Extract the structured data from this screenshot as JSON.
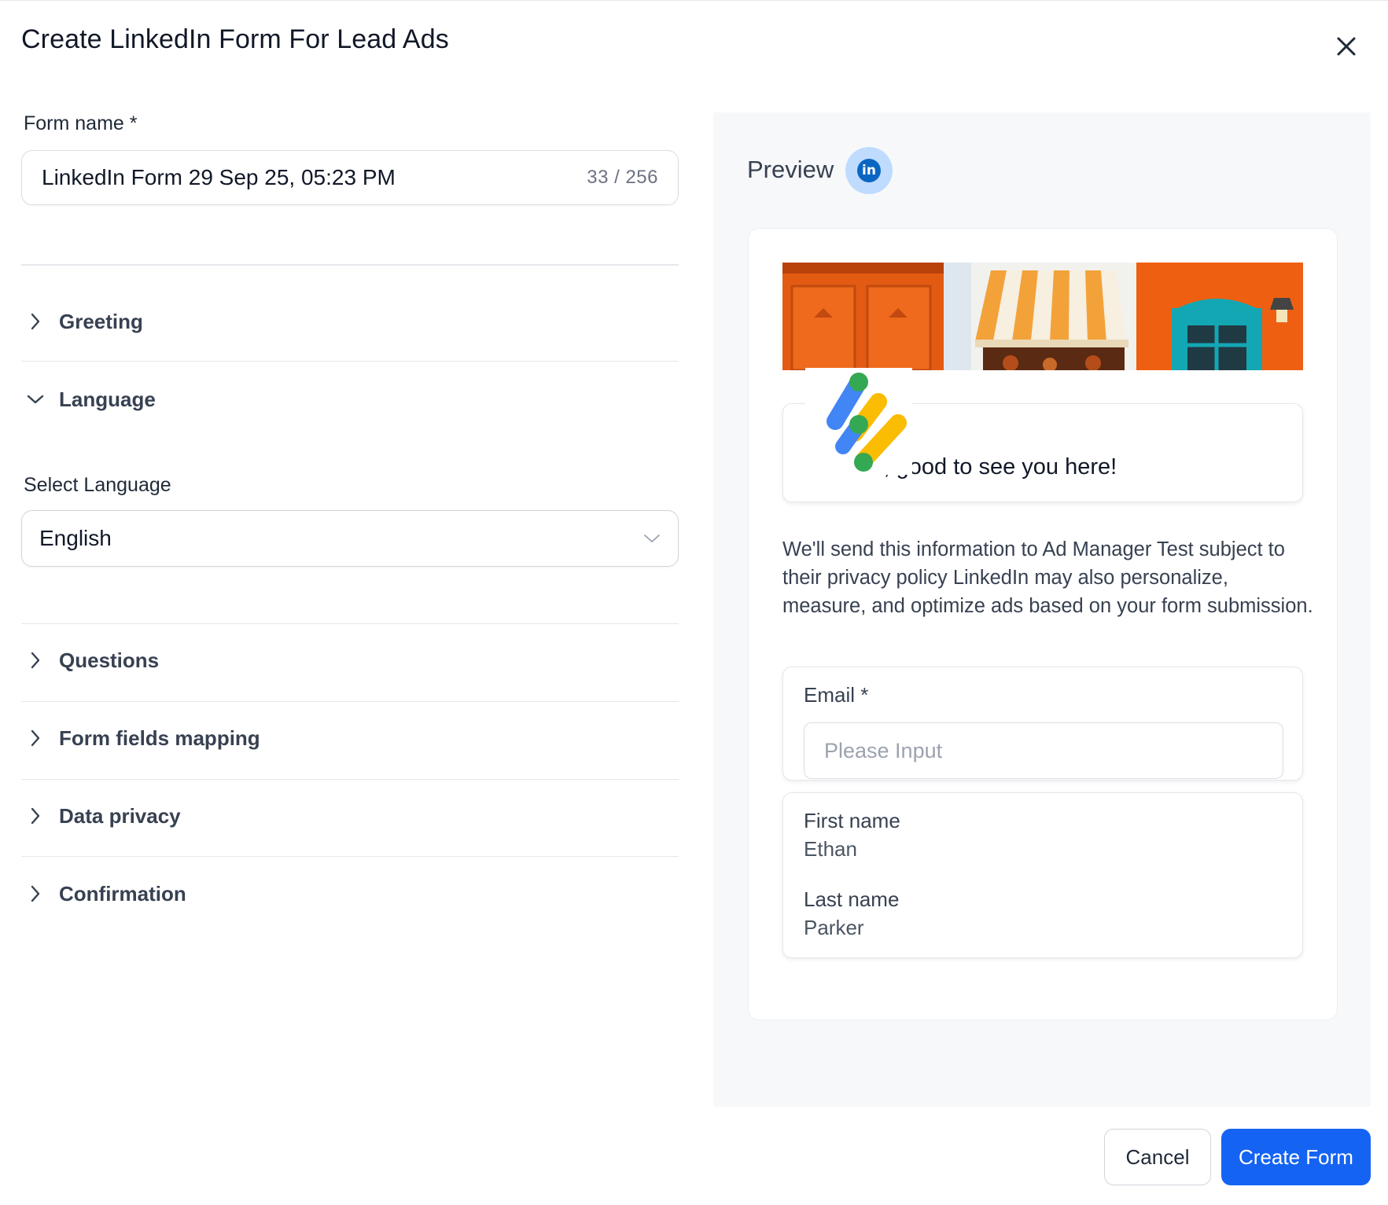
{
  "modal": {
    "title": "Create LinkedIn Form For Lead Ads"
  },
  "form": {
    "name_label": "Form name *",
    "name_value": "LinkedIn Form 29 Sep 25, 05:23 PM",
    "name_counter": "33 / 256"
  },
  "sections": {
    "greeting": "Greeting",
    "language": "Language",
    "questions": "Questions",
    "form_fields_mapping": "Form fields mapping",
    "data_privacy": "Data privacy",
    "confirmation": "Confirmation"
  },
  "language": {
    "select_label": "Select Language",
    "selected": "English"
  },
  "preview": {
    "title": "Preview",
    "badge": "in",
    "greeting_text": "Hi there, good to see you here!",
    "privacy_text": "We'll send this information to Ad Manager Test subject to their privacy policy LinkedIn may also personalize, measure, and optimize ads based on your form submission.",
    "email_label": "Email *",
    "email_placeholder": "Please Input",
    "first_name_label": "First name",
    "first_name_value": "Ethan",
    "last_name_label": "Last name",
    "last_name_value": "Parker"
  },
  "footer": {
    "cancel_label": "Cancel",
    "create_label": "Create Form"
  },
  "colors": {
    "primary": "#1463f3",
    "linkedin": "#0a66c2",
    "panel_bg": "#f7f8fa"
  }
}
